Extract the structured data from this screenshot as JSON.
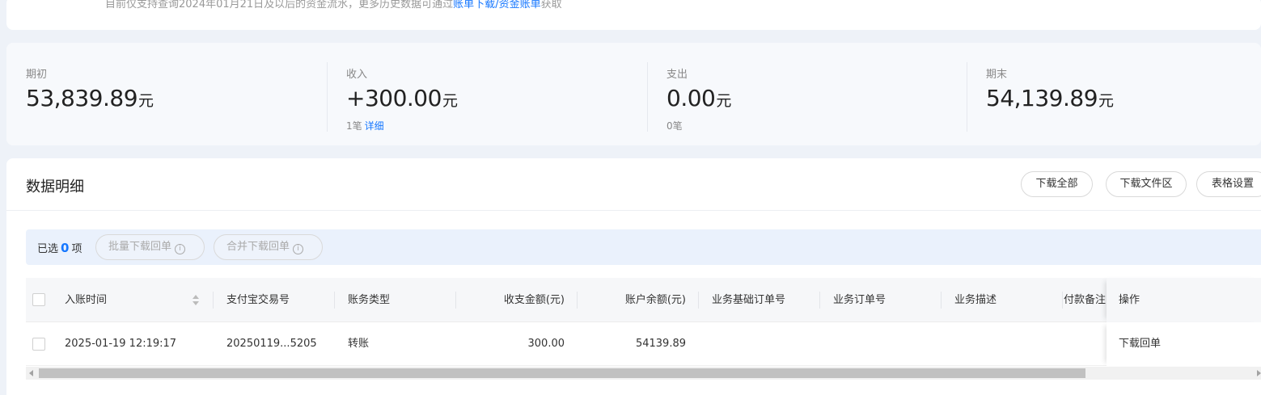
{
  "notice": {
    "text_before": "目前仅支持查询2024年01月21日及以后的资金流水，更多历史数据可通过",
    "link_bill": "账单下载",
    "slash": "/",
    "link_fund": "资金账单",
    "text_after": "获取"
  },
  "summary": {
    "opening": {
      "label": "期初",
      "amount": "53,839.89",
      "unit": "元"
    },
    "income": {
      "label": "收入",
      "amount": "+300.00",
      "unit": "元",
      "count": "1笔",
      "detail_link": "详细"
    },
    "expense": {
      "label": "支出",
      "amount": "0.00",
      "unit": "元",
      "count": "0笔"
    },
    "closing": {
      "label": "期末",
      "amount": "54,139.89",
      "unit": "元"
    }
  },
  "detail": {
    "title": "数据明细",
    "buttons": {
      "download_all": "下载全部",
      "download_files": "下载文件区",
      "table_settings": "表格设置"
    },
    "selection": {
      "prefix": "已选",
      "count": "0",
      "suffix": "项",
      "batch_download": "批量下载回单",
      "merge_download": "合并下载回单"
    },
    "columns": [
      "入账时间",
      "支付宝交易号",
      "账务类型",
      "收支金额(元)",
      "账户余额(元)",
      "业务基础订单号",
      "业务订单号",
      "业务描述",
      "付款备注",
      "操作"
    ],
    "rows": [
      {
        "time": "2025-01-19 12:19:17",
        "trade_no": "20250119...5205",
        "type": "转账",
        "amount": "300.00",
        "balance": "54139.89",
        "base_order": "",
        "order": "",
        "desc": "",
        "remark": "",
        "action": "下载回单"
      }
    ]
  }
}
